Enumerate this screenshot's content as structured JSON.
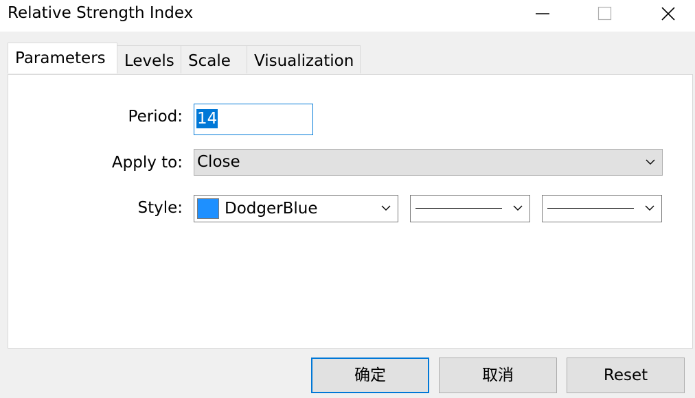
{
  "window": {
    "title": "Relative Strength Index",
    "controls": {
      "minimize": "minimize-icon",
      "maximize": "maximize-icon",
      "close": "close-icon"
    }
  },
  "tabs": [
    {
      "label": "Parameters",
      "active": true
    },
    {
      "label": "Levels",
      "active": false
    },
    {
      "label": "Scale",
      "active": false
    },
    {
      "label": "Visualization",
      "active": false
    }
  ],
  "form": {
    "period": {
      "label": "Period:",
      "value": "14"
    },
    "apply_to": {
      "label": "Apply to:",
      "value": "Close"
    },
    "style": {
      "label": "Style:",
      "color_name": "DodgerBlue",
      "color_hex": "#1e90ff",
      "line_style": "solid",
      "line_width": "thin"
    }
  },
  "buttons": {
    "ok": "确定",
    "cancel": "取消",
    "reset": "Reset"
  },
  "colors": {
    "accent": "#0078d7",
    "swatch": "#1e90ff",
    "panel": "#ffffff",
    "background": "#f0f0f0"
  }
}
